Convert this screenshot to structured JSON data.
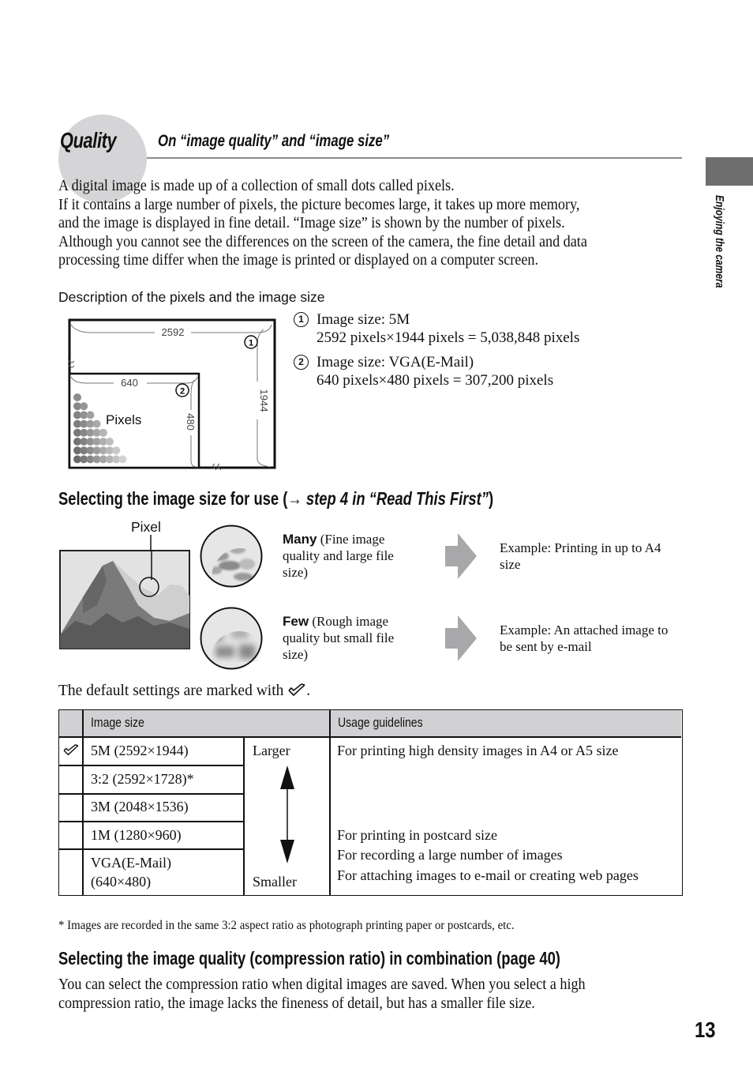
{
  "header": {
    "section_title": "Quality",
    "subtitle": "On “image quality” and “image size”"
  },
  "side_tab": {
    "label": "Enjoying the camera"
  },
  "intro": {
    "lines": [
      "A digital image is made up of a collection of small dots called pixels.",
      "If it contains a large number of pixels, the picture becomes large, it takes up more memory,",
      "and the image is displayed in fine detail. “Image size” is shown by the number of pixels.",
      "Although you cannot see the differences on the screen of the camera, the fine detail and data",
      "processing time differ when the image is printed or displayed on a computer screen."
    ]
  },
  "pixel_diagram": {
    "caption": "Description of the pixels and the image size",
    "outer_width_label": "2592",
    "outer_height_label": "1944",
    "inner_width_label": "640",
    "inner_height_label": "480",
    "pixels_label": "Pixels",
    "marker_1": "1",
    "marker_2": "2"
  },
  "legend": [
    {
      "number": "1",
      "line1": "Image size: 5M",
      "line2": "2592 pixels×1944 pixels = 5,038,848 pixels"
    },
    {
      "number": "2",
      "line1": "Image size: VGA(E-Mail)",
      "line2": "640 pixels×480 pixels = 307,200 pixels"
    }
  ],
  "section2": {
    "title_plain": "Selecting the image size for use (→ ",
    "title_italic": "step 4 in “Read This First”",
    "title_close": ")",
    "pixel_label": "Pixel",
    "rows": [
      {
        "bold": "Many",
        "desc": " (Fine image quality and large file size)",
        "example": "Example: Printing in up to A4 size"
      },
      {
        "bold": "Few",
        "desc": " (Rough image quality but small file size)",
        "example": "Example: An attached image to be sent by e-mail"
      }
    ]
  },
  "default_note": {
    "text": "The default settings are marked with",
    "suffix": ".",
    "icon": "checkmark-icon"
  },
  "table": {
    "headers": [
      "Image size",
      "Usage guidelines"
    ],
    "rows": [
      {
        "default": true,
        "size": "5M (2592×1944)"
      },
      {
        "default": false,
        "size": "3:2 (2592×1728)*"
      },
      {
        "default": false,
        "size": "3M (2048×1536)"
      },
      {
        "default": false,
        "size": "1M (1280×960)"
      },
      {
        "default": false,
        "size_line1": "VGA(E-Mail)",
        "size_line2": "(640×480)"
      }
    ],
    "scale_top": "Larger",
    "scale_bottom": "Smaller",
    "usage": [
      "For printing high density images in A4 or A5 size",
      "For printing in postcard size",
      "For recording a large number of images",
      "For attaching images to e-mail or creating web pages"
    ]
  },
  "footnote": "* Images are recorded in the same 3:2 aspect ratio as photograph printing paper or postcards, etc.",
  "section3": {
    "title": "Selecting the image quality (compression ratio) in combination (page 40)",
    "lines": [
      "You can select the compression ratio when digital images are saved. When you select a high",
      "compression ratio, the image lacks the fineness of detail, but has a smaller file size."
    ]
  },
  "page_number": "13",
  "colors": {
    "accent_circle": "#d5d5d7",
    "side_tab": "#6e6e6e",
    "table_header": "#d1d1d3",
    "arrow": "#a8a8aa",
    "rule": "#8a8a8a"
  }
}
